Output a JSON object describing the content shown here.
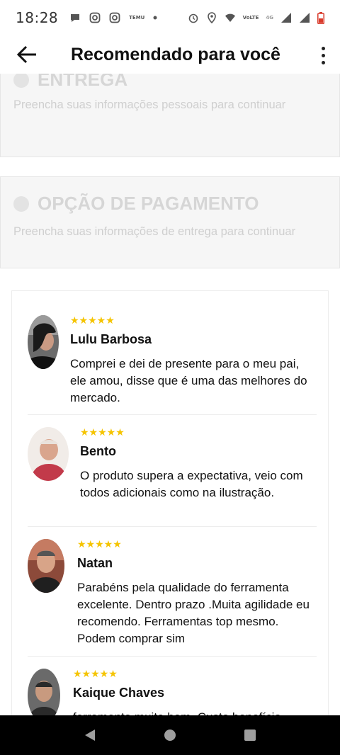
{
  "status_bar": {
    "time": "18:28",
    "temu_label": "TEMU",
    "volte_label": "VoLTE",
    "network_label": "4G"
  },
  "app_bar": {
    "title": "Recomendado para você"
  },
  "steps": [
    {
      "title": "ENTREGA",
      "description": "Preencha suas informações pessoais para continuar"
    },
    {
      "title": "OPÇÃO DE PAGAMENTO",
      "description": "Preencha suas informações de entrega para continuar"
    }
  ],
  "reviews": [
    {
      "stars": "★★★★★",
      "rating": 5,
      "name": "Lulu Barbosa",
      "text": "Comprei e dei de presente para o meu pai, ele amou, disse que é uma das melhores do mercado."
    },
    {
      "stars": "★★★★★",
      "rating": 5,
      "name": "Bento",
      "text": "O produto supera a expectativa, veio com todos adicionais como na ilustração."
    },
    {
      "stars": "★★★★★",
      "rating": 5,
      "name": "Natan",
      "text": "Parabéns pela qualidade do ferramenta excelente. Dentro prazo .Muita agilidade eu recomendo. Ferramentas top mesmo. Podem comprar sim"
    },
    {
      "stars": "★★★★★",
      "rating": 5,
      "name": "Kaique Chaves",
      "text": "ferramenta muito bom. Custo benefício"
    }
  ],
  "colors": {
    "star": "#f5c400",
    "disabled_text": "#d6d6d6",
    "nav_bar": "#000000"
  }
}
